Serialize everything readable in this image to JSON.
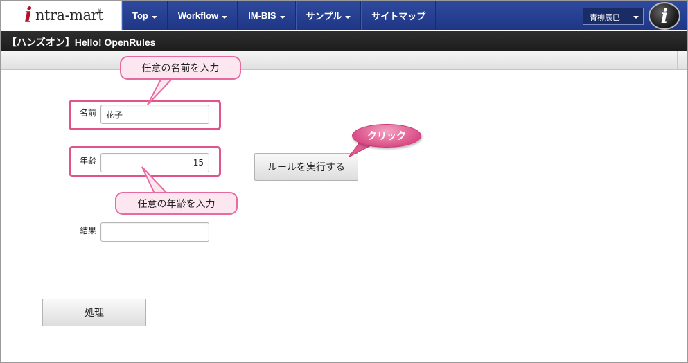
{
  "app": {
    "logo_text": "ntra-mart",
    "logo_mark": "i",
    "logo_reg": "®"
  },
  "nav": {
    "items": [
      {
        "label": "Top",
        "has_caret": true
      },
      {
        "label": "Workflow",
        "has_caret": true
      },
      {
        "label": "IM-BIS",
        "has_caret": true
      },
      {
        "label": "サンプル",
        "has_caret": true
      },
      {
        "label": "サイトマップ",
        "has_caret": false
      }
    ],
    "user_name": "青柳辰巳",
    "help_icon": "i"
  },
  "page": {
    "title": "【ハンズオン】Hello! OpenRules"
  },
  "form": {
    "name_label": "名前",
    "name_value": "花子",
    "age_label": "年齢",
    "age_value": "15",
    "result_label": "結果",
    "result_value": "",
    "run_button": "ルールを実行する",
    "process_button": "処理"
  },
  "callouts": {
    "name_hint": "任意の名前を入力",
    "age_hint": "任意の年齢を入力",
    "click": "クリック"
  },
  "colors": {
    "nav_bg": "#2a4394",
    "title_bg": "#262626",
    "highlight": "#e1548a",
    "bubble_bg": "#fce7f1"
  }
}
